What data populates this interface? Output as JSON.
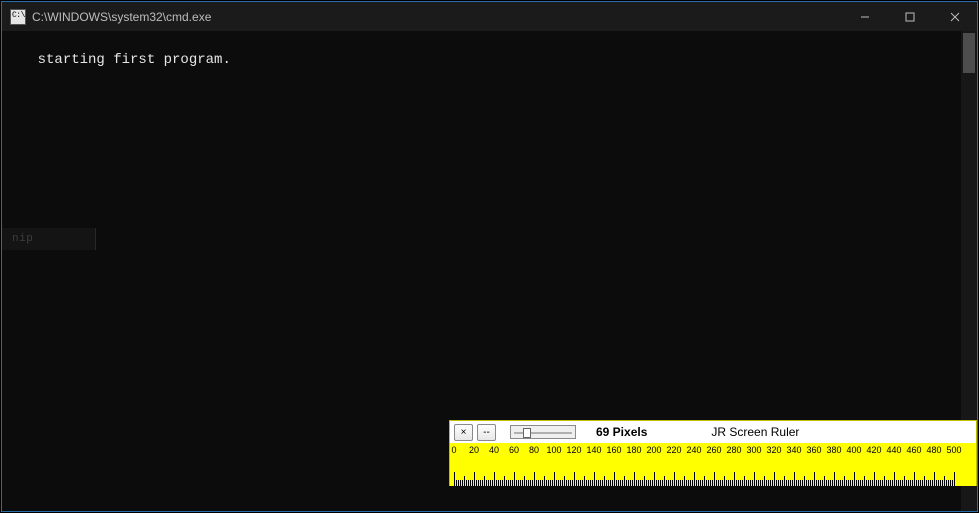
{
  "cmd": {
    "icon_text": "C:\\",
    "title": "C:\\WINDOWS\\system32\\cmd.exe",
    "output": "starting first program.",
    "ghost_label": "nip"
  },
  "ruler": {
    "close_label": "×",
    "menu_label": "--",
    "reading_value": "69 Pixels",
    "app_name": "JR Screen Ruler",
    "tick_labels": [
      "0",
      "20",
      "40",
      "60",
      "80",
      "100",
      "120",
      "140",
      "160",
      "180",
      "200",
      "220",
      "240",
      "260",
      "280",
      "300",
      "320",
      "340",
      "360",
      "380",
      "400",
      "420",
      "440",
      "460",
      "480",
      "500"
    ],
    "tick_spacing_px": 20,
    "minor_per_major": 10
  }
}
